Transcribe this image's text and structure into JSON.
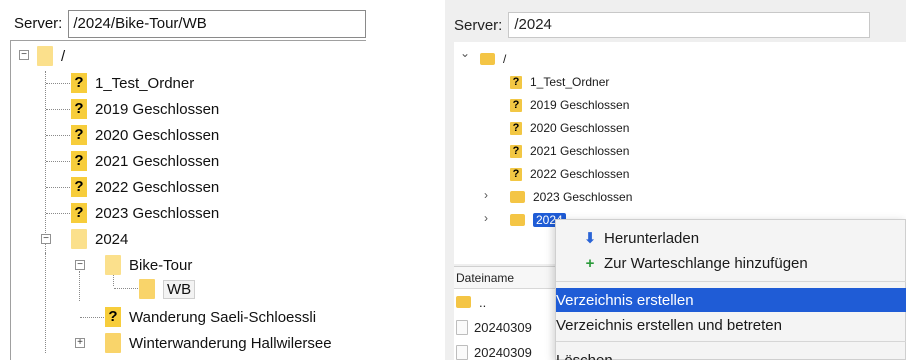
{
  "left": {
    "server_label": "Server:",
    "server_path": "/2024/Bike-Tour/WB",
    "tree": {
      "root": "/",
      "items": [
        "1_Test_Ordner",
        "2019 Geschlossen",
        "2020 Geschlossen",
        "2021 Geschlossen",
        "2022 Geschlossen",
        "2023 Geschlossen",
        "2024",
        "Bike-Tour",
        "WB",
        "Wanderung Saeli-Schloessli",
        "Winterwanderung Hallwilersee"
      ],
      "unknown_glyph": "?",
      "minus_glyph": "−",
      "plus_glyph": "+"
    }
  },
  "right": {
    "server_label": "Server:",
    "server_path": "/2024",
    "tree": {
      "root": "/",
      "items": [
        "1_Test_Ordner",
        "2019 Geschlossen",
        "2020 Geschlossen",
        "2021 Geschlossen",
        "2022 Geschlossen",
        "2023 Geschlossen",
        "2024"
      ],
      "unknown_glyph": "?",
      "chevron_down": "⌄",
      "chevron_right": "›"
    },
    "list": {
      "column_header": "Dateiname",
      "rows": [
        "..",
        "20240309",
        "20240309"
      ]
    },
    "context_menu": {
      "items": [
        "Herunterladen",
        "Zur Warteschlange hinzufügen",
        "Verzeichnis erstellen",
        "Verzeichnis erstellen und betreten",
        "Löschen"
      ],
      "highlighted": "Verzeichnis erstellen",
      "download_glyph": "⬇",
      "queue_glyph": "+"
    }
  },
  "colors": {
    "selection_blue": "#1f5cd6",
    "folder_yellow": "#f9d46a",
    "unknown_icon_yellow": "#f7cd3b"
  }
}
